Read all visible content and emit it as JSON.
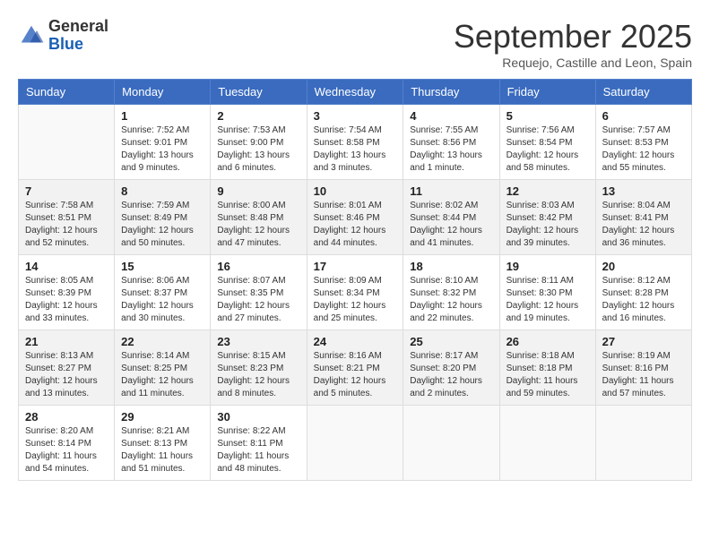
{
  "logo": {
    "text_general": "General",
    "text_blue": "Blue"
  },
  "header": {
    "month": "September 2025",
    "location": "Requejo, Castille and Leon, Spain"
  },
  "days_of_week": [
    "Sunday",
    "Monday",
    "Tuesday",
    "Wednesday",
    "Thursday",
    "Friday",
    "Saturday"
  ],
  "weeks": [
    [
      {
        "day": "",
        "sunrise": "",
        "sunset": "",
        "daylight": ""
      },
      {
        "day": "1",
        "sunrise": "Sunrise: 7:52 AM",
        "sunset": "Sunset: 9:01 PM",
        "daylight": "Daylight: 13 hours and 9 minutes."
      },
      {
        "day": "2",
        "sunrise": "Sunrise: 7:53 AM",
        "sunset": "Sunset: 9:00 PM",
        "daylight": "Daylight: 13 hours and 6 minutes."
      },
      {
        "day": "3",
        "sunrise": "Sunrise: 7:54 AM",
        "sunset": "Sunset: 8:58 PM",
        "daylight": "Daylight: 13 hours and 3 minutes."
      },
      {
        "day": "4",
        "sunrise": "Sunrise: 7:55 AM",
        "sunset": "Sunset: 8:56 PM",
        "daylight": "Daylight: 13 hours and 1 minute."
      },
      {
        "day": "5",
        "sunrise": "Sunrise: 7:56 AM",
        "sunset": "Sunset: 8:54 PM",
        "daylight": "Daylight: 12 hours and 58 minutes."
      },
      {
        "day": "6",
        "sunrise": "Sunrise: 7:57 AM",
        "sunset": "Sunset: 8:53 PM",
        "daylight": "Daylight: 12 hours and 55 minutes."
      }
    ],
    [
      {
        "day": "7",
        "sunrise": "Sunrise: 7:58 AM",
        "sunset": "Sunset: 8:51 PM",
        "daylight": "Daylight: 12 hours and 52 minutes."
      },
      {
        "day": "8",
        "sunrise": "Sunrise: 7:59 AM",
        "sunset": "Sunset: 8:49 PM",
        "daylight": "Daylight: 12 hours and 50 minutes."
      },
      {
        "day": "9",
        "sunrise": "Sunrise: 8:00 AM",
        "sunset": "Sunset: 8:48 PM",
        "daylight": "Daylight: 12 hours and 47 minutes."
      },
      {
        "day": "10",
        "sunrise": "Sunrise: 8:01 AM",
        "sunset": "Sunset: 8:46 PM",
        "daylight": "Daylight: 12 hours and 44 minutes."
      },
      {
        "day": "11",
        "sunrise": "Sunrise: 8:02 AM",
        "sunset": "Sunset: 8:44 PM",
        "daylight": "Daylight: 12 hours and 41 minutes."
      },
      {
        "day": "12",
        "sunrise": "Sunrise: 8:03 AM",
        "sunset": "Sunset: 8:42 PM",
        "daylight": "Daylight: 12 hours and 39 minutes."
      },
      {
        "day": "13",
        "sunrise": "Sunrise: 8:04 AM",
        "sunset": "Sunset: 8:41 PM",
        "daylight": "Daylight: 12 hours and 36 minutes."
      }
    ],
    [
      {
        "day": "14",
        "sunrise": "Sunrise: 8:05 AM",
        "sunset": "Sunset: 8:39 PM",
        "daylight": "Daylight: 12 hours and 33 minutes."
      },
      {
        "day": "15",
        "sunrise": "Sunrise: 8:06 AM",
        "sunset": "Sunset: 8:37 PM",
        "daylight": "Daylight: 12 hours and 30 minutes."
      },
      {
        "day": "16",
        "sunrise": "Sunrise: 8:07 AM",
        "sunset": "Sunset: 8:35 PM",
        "daylight": "Daylight: 12 hours and 27 minutes."
      },
      {
        "day": "17",
        "sunrise": "Sunrise: 8:09 AM",
        "sunset": "Sunset: 8:34 PM",
        "daylight": "Daylight: 12 hours and 25 minutes."
      },
      {
        "day": "18",
        "sunrise": "Sunrise: 8:10 AM",
        "sunset": "Sunset: 8:32 PM",
        "daylight": "Daylight: 12 hours and 22 minutes."
      },
      {
        "day": "19",
        "sunrise": "Sunrise: 8:11 AM",
        "sunset": "Sunset: 8:30 PM",
        "daylight": "Daylight: 12 hours and 19 minutes."
      },
      {
        "day": "20",
        "sunrise": "Sunrise: 8:12 AM",
        "sunset": "Sunset: 8:28 PM",
        "daylight": "Daylight: 12 hours and 16 minutes."
      }
    ],
    [
      {
        "day": "21",
        "sunrise": "Sunrise: 8:13 AM",
        "sunset": "Sunset: 8:27 PM",
        "daylight": "Daylight: 12 hours and 13 minutes."
      },
      {
        "day": "22",
        "sunrise": "Sunrise: 8:14 AM",
        "sunset": "Sunset: 8:25 PM",
        "daylight": "Daylight: 12 hours and 11 minutes."
      },
      {
        "day": "23",
        "sunrise": "Sunrise: 8:15 AM",
        "sunset": "Sunset: 8:23 PM",
        "daylight": "Daylight: 12 hours and 8 minutes."
      },
      {
        "day": "24",
        "sunrise": "Sunrise: 8:16 AM",
        "sunset": "Sunset: 8:21 PM",
        "daylight": "Daylight: 12 hours and 5 minutes."
      },
      {
        "day": "25",
        "sunrise": "Sunrise: 8:17 AM",
        "sunset": "Sunset: 8:20 PM",
        "daylight": "Daylight: 12 hours and 2 minutes."
      },
      {
        "day": "26",
        "sunrise": "Sunrise: 8:18 AM",
        "sunset": "Sunset: 8:18 PM",
        "daylight": "Daylight: 11 hours and 59 minutes."
      },
      {
        "day": "27",
        "sunrise": "Sunrise: 8:19 AM",
        "sunset": "Sunset: 8:16 PM",
        "daylight": "Daylight: 11 hours and 57 minutes."
      }
    ],
    [
      {
        "day": "28",
        "sunrise": "Sunrise: 8:20 AM",
        "sunset": "Sunset: 8:14 PM",
        "daylight": "Daylight: 11 hours and 54 minutes."
      },
      {
        "day": "29",
        "sunrise": "Sunrise: 8:21 AM",
        "sunset": "Sunset: 8:13 PM",
        "daylight": "Daylight: 11 hours and 51 minutes."
      },
      {
        "day": "30",
        "sunrise": "Sunrise: 8:22 AM",
        "sunset": "Sunset: 8:11 PM",
        "daylight": "Daylight: 11 hours and 48 minutes."
      },
      {
        "day": "",
        "sunrise": "",
        "sunset": "",
        "daylight": ""
      },
      {
        "day": "",
        "sunrise": "",
        "sunset": "",
        "daylight": ""
      },
      {
        "day": "",
        "sunrise": "",
        "sunset": "",
        "daylight": ""
      },
      {
        "day": "",
        "sunrise": "",
        "sunset": "",
        "daylight": ""
      }
    ]
  ]
}
